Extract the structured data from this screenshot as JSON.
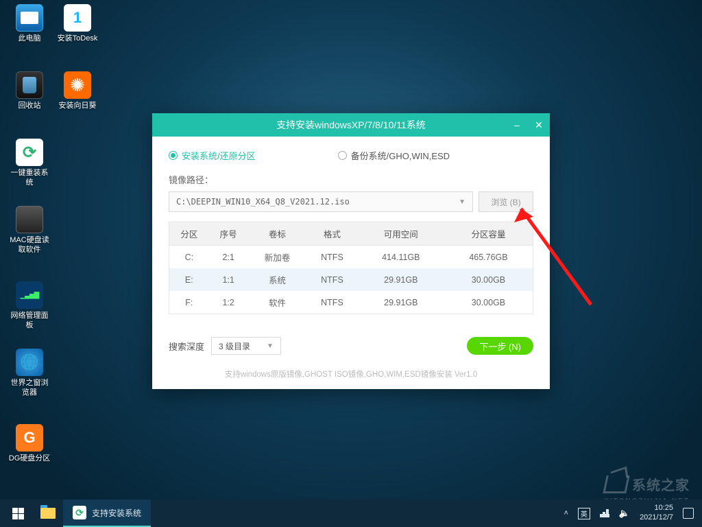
{
  "desktop_icons": {
    "this_pc": "此电脑",
    "todesk": "安装ToDesk",
    "recycle": "回收站",
    "sunflower": "安装向日葵",
    "reinstall": "一键重装系统",
    "mac_reader": "MAC硬盘读取软件",
    "net_panel": "网络管理面板",
    "world_browser": "世界之窗浏览器",
    "dg": "DG硬盘分区"
  },
  "window": {
    "title": "支持安装windowsXP/7/8/10/11系统",
    "radio_install": "安装系统/还原分区",
    "radio_backup": "备份系统/GHO,WIN,ESD",
    "image_path_label": "镜像路径：",
    "image_path_value": "C:\\DEEPIN_WIN10_X64_Q8_V2021.12.iso",
    "browse_btn": "浏览 (B)",
    "table_headers": [
      "分区",
      "序号",
      "卷标",
      "格式",
      "可用空间",
      "分区容量"
    ],
    "table_rows": [
      {
        "part": "C:",
        "idx": "2:1",
        "vol": "新加卷",
        "fmt": "NTFS",
        "free": "414.11GB",
        "cap": "465.76GB",
        "sel": false
      },
      {
        "part": "E:",
        "idx": "1:1",
        "vol": "系统",
        "fmt": "NTFS",
        "free": "29.91GB",
        "cap": "30.00GB",
        "sel": true
      },
      {
        "part": "F:",
        "idx": "1:2",
        "vol": "软件",
        "fmt": "NTFS",
        "free": "29.91GB",
        "cap": "30.00GB",
        "sel": false
      }
    ],
    "search_depth_label": "搜索深度",
    "search_depth_value": "3 级目录",
    "next_btn": "下一步 (N)",
    "footnote": "支持windows原版镜像,GHOST ISO镜像,GHO,WIM,ESD镜像安装 Ver1.0"
  },
  "taskbar": {
    "app_title": "支持安装系统",
    "ime": "英",
    "time": "10:25",
    "date": "2021/12/7"
  },
  "watermark": {
    "text": "系统之家",
    "sub": "XITONGZHIJIA.NET"
  }
}
